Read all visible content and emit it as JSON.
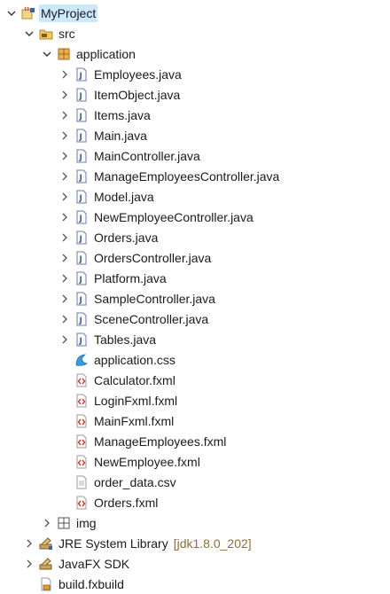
{
  "tree": {
    "project": {
      "label": "MyProject",
      "icon": "java-project-icon"
    },
    "src": {
      "label": "src",
      "icon": "source-folder-icon"
    },
    "package": {
      "label": "application",
      "icon": "package-icon"
    },
    "java_files": [
      {
        "label": "Employees.java"
      },
      {
        "label": "ItemObject.java"
      },
      {
        "label": "Items.java"
      },
      {
        "label": "Main.java"
      },
      {
        "label": "MainController.java"
      },
      {
        "label": "ManageEmployeesController.java"
      },
      {
        "label": "Model.java"
      },
      {
        "label": "NewEmployeeController.java"
      },
      {
        "label": "Orders.java"
      },
      {
        "label": "OrdersController.java"
      },
      {
        "label": "Platform.java"
      },
      {
        "label": "SampleController.java"
      },
      {
        "label": "SceneController.java"
      },
      {
        "label": "Tables.java"
      }
    ],
    "css_file": {
      "label": "application.css"
    },
    "fxml_files": [
      {
        "label": "Calculator.fxml"
      },
      {
        "label": "LoginFxml.fxml"
      },
      {
        "label": "MainFxml.fxml"
      },
      {
        "label": "ManageEmployees.fxml"
      },
      {
        "label": "NewEmployee.fxml"
      }
    ],
    "csv_file": {
      "label": "order_data.csv"
    },
    "orders_fxml": {
      "label": "Orders.fxml"
    },
    "img": {
      "label": "img"
    },
    "jre": {
      "label": "JRE System Library",
      "decoration": "[jdk1.8.0_202]"
    },
    "javafx": {
      "label": "JavaFX SDK"
    },
    "build": {
      "label": "build.fxbuild"
    }
  },
  "colors": {
    "selection": "#cce8ff",
    "decoration": "#8a6d3b",
    "java_icon_blue": "#3b5fa8",
    "fxml_red": "#d2362b"
  }
}
